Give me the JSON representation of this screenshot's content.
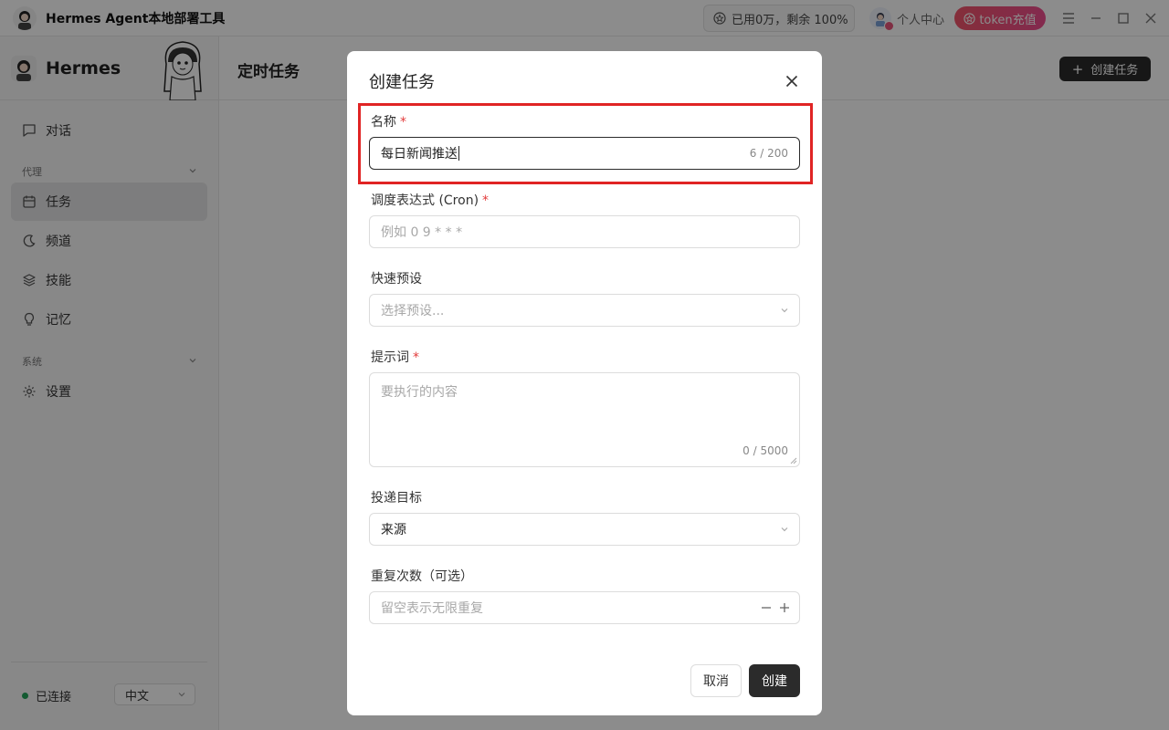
{
  "titlebar": {
    "app_title": "Hermes Agent本地部署工具",
    "usage": "已用0万，剩余 100%",
    "profile_label": "个人中心",
    "token_button": "token充值"
  },
  "sidebar": {
    "brand": "Hermes",
    "items": [
      {
        "label": "对话",
        "icon": "chat-icon"
      },
      {
        "label": "任务",
        "icon": "calendar-icon"
      },
      {
        "label": "频道",
        "icon": "moon-icon"
      },
      {
        "label": "技能",
        "icon": "layers-icon"
      },
      {
        "label": "记忆",
        "icon": "bulb-icon"
      },
      {
        "label": "设置",
        "icon": "gear-icon"
      }
    ],
    "groups": [
      "代理",
      "系统"
    ],
    "status": "已连接",
    "language": "中文"
  },
  "main": {
    "page_title": "定时任务",
    "create_button": "创建任务"
  },
  "modal": {
    "title": "创建任务",
    "name": {
      "label": "名称",
      "value": "每日新闻推送",
      "count": "6 / 200"
    },
    "cron": {
      "label": "调度表达式 (Cron)",
      "placeholder": "例如 0 9 * * *"
    },
    "preset": {
      "label": "快速预设",
      "placeholder": "选择预设..."
    },
    "prompt": {
      "label": "提示词",
      "placeholder": "要执行的内容",
      "count": "0 / 5000"
    },
    "target": {
      "label": "投递目标",
      "value": "来源"
    },
    "repeat": {
      "label": "重复次数（可选）",
      "placeholder": "留空表示无限重复"
    },
    "cancel": "取消",
    "create": "创建"
  },
  "colors": {
    "accent": "#2b2b2b",
    "required": "#e23b3b",
    "highlight": "#e02424",
    "token_gradient": "#f0556a",
    "connected": "#23a559"
  }
}
